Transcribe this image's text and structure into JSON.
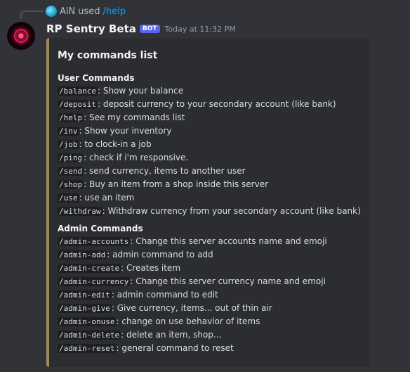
{
  "reply": {
    "user": "AiN",
    "action": "used",
    "command": "/help"
  },
  "message": {
    "username": "RP Sentry Beta",
    "badge": "BOT",
    "timestamp": "Today at 11:32 PM"
  },
  "embed": {
    "title": "My commands list",
    "sections": [
      {
        "title": "User Commands",
        "commands": [
          {
            "name": "/balance",
            "desc": "Show your balance"
          },
          {
            "name": "/deposit",
            "desc": "deposit currency to your secondary account (like bank)"
          },
          {
            "name": "/help",
            "desc": "See my commands list"
          },
          {
            "name": "/inv",
            "desc": "Show your inventory"
          },
          {
            "name": "/job",
            "desc": "to clock-in a job"
          },
          {
            "name": "/ping",
            "desc": "check if i'm responsive."
          },
          {
            "name": "/send",
            "desc": "send currency, items to another user"
          },
          {
            "name": "/shop",
            "desc": "Buy an item from a shop inside this server"
          },
          {
            "name": "/use",
            "desc": "use an item"
          },
          {
            "name": "/withdraw",
            "desc": "Withdraw currency from your secondary account (like bank)"
          }
        ]
      },
      {
        "title": "Admin Commands",
        "commands": [
          {
            "name": "/admin-accounts",
            "desc": "Change this server accounts name and emoji"
          },
          {
            "name": "/admin-add",
            "desc": "admin command to add"
          },
          {
            "name": "/admin-create",
            "desc": "Creates item"
          },
          {
            "name": "/admin-currency",
            "desc": "Change this server currency name and emoji"
          },
          {
            "name": "/admin-edit",
            "desc": "admin command to edit"
          },
          {
            "name": "/admin-give",
            "desc": "Give currency, items... out of thin air"
          },
          {
            "name": "/admin-onuse",
            "desc": "change on use behavior of items"
          },
          {
            "name": "/admin-delete",
            "desc": "delete an item, shop..."
          },
          {
            "name": "/admin-reset",
            "desc": "general command to reset"
          }
        ]
      }
    ]
  }
}
